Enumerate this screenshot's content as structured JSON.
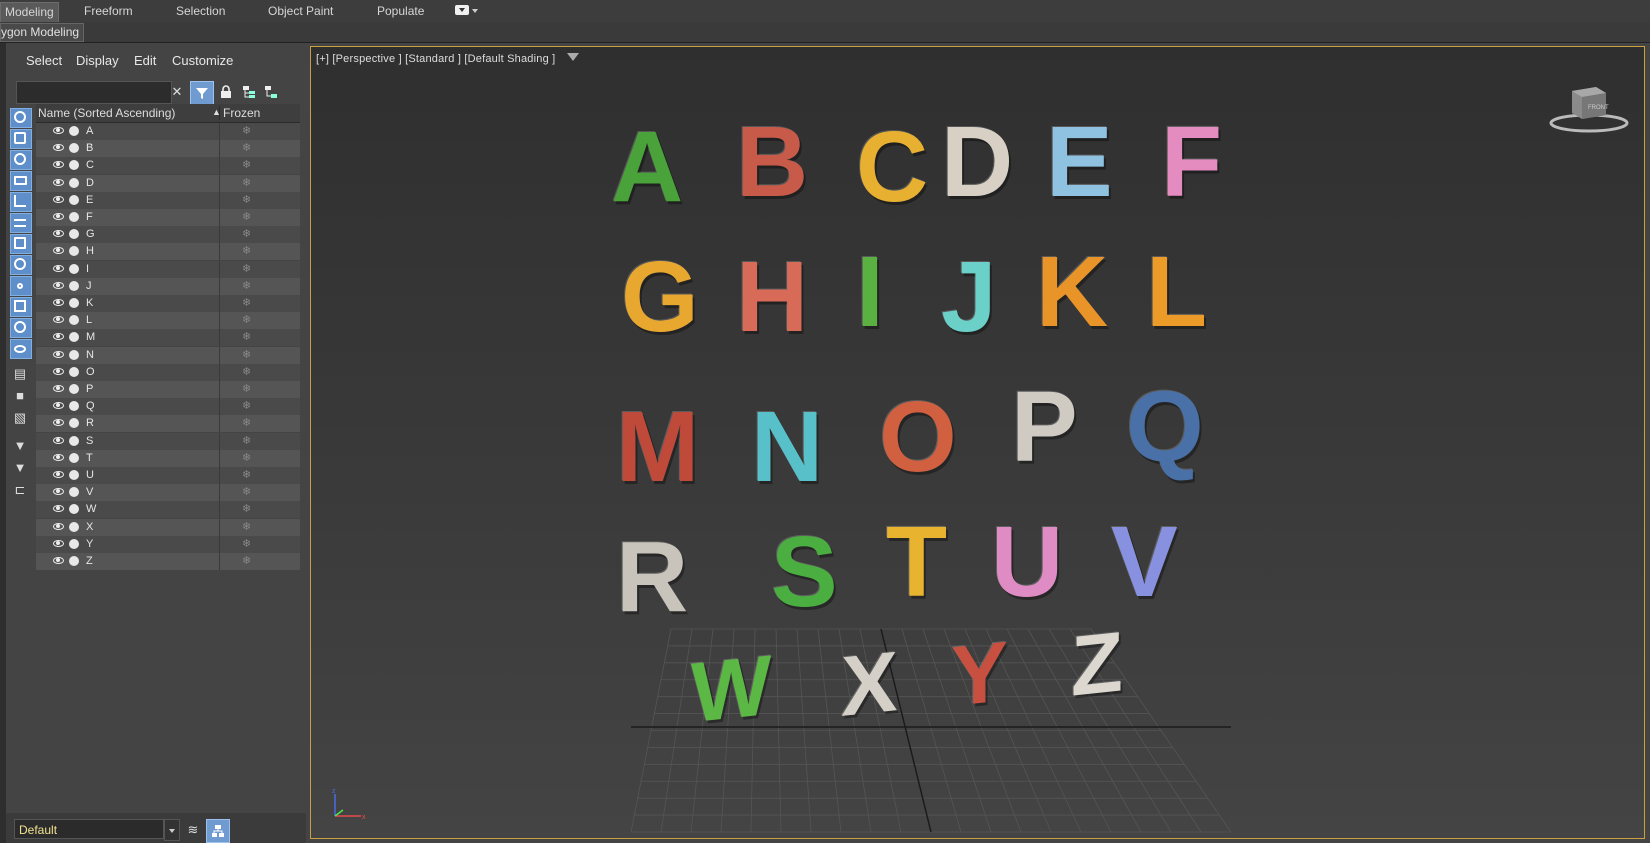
{
  "ribbon": {
    "tabs": [
      "Modeling",
      "Freeform",
      "Selection",
      "Object Paint",
      "Populate"
    ],
    "active": "Modeling",
    "sub_tab": "ygon Modeling"
  },
  "scene_explorer": {
    "menu": [
      "Select",
      "Display",
      "Edit",
      "Customize"
    ],
    "search_placeholder": "",
    "column_name": "Name (Sorted Ascending)",
    "column_frozen": "Frozen",
    "sort_indicator": "▲",
    "objects": [
      "A",
      "B",
      "C",
      "D",
      "E",
      "F",
      "G",
      "H",
      "I",
      "J",
      "K",
      "L",
      "M",
      "N",
      "O",
      "P",
      "Q",
      "R",
      "S",
      "T",
      "U",
      "V",
      "W",
      "X",
      "Y",
      "Z"
    ],
    "frozen_icon": "❄",
    "layer": "Default"
  },
  "viewport": {
    "label": "[+] [Perspective ] [Standard ] [Default Shading ]",
    "viewcube_label": "FRONT",
    "letters": [
      {
        "ch": "A",
        "color": "#4aa33a"
      },
      {
        "ch": "B",
        "color": "#c85a4a"
      },
      {
        "ch": "C",
        "color": "#e8b030"
      },
      {
        "ch": "D",
        "color": "#d8d0c4"
      },
      {
        "ch": "E",
        "color": "#8ec2e0"
      },
      {
        "ch": "F",
        "color": "#e48cc0"
      },
      {
        "ch": "G",
        "color": "#e8a830"
      },
      {
        "ch": "H",
        "color": "#d86a58"
      },
      {
        "ch": "I",
        "color": "#5ab040"
      },
      {
        "ch": "J",
        "color": "#6ad0c8"
      },
      {
        "ch": "K",
        "color": "#e89428"
      },
      {
        "ch": "L",
        "color": "#ec9a28"
      },
      {
        "ch": "M",
        "color": "#c04a3a"
      },
      {
        "ch": "N",
        "color": "#58c0c8"
      },
      {
        "ch": "O",
        "color": "#d06040"
      },
      {
        "ch": "P",
        "color": "#cfcac2"
      },
      {
        "ch": "Q",
        "color": "#4a70a8"
      },
      {
        "ch": "R",
        "color": "#c8c4bc"
      },
      {
        "ch": "S",
        "color": "#4aae40"
      },
      {
        "ch": "T",
        "color": "#e8b430"
      },
      {
        "ch": "U",
        "color": "#e08cc4"
      },
      {
        "ch": "V",
        "color": "#8890e0"
      },
      {
        "ch": "W",
        "color": "#5cb844"
      },
      {
        "ch": "X",
        "color": "#d4d0c8"
      },
      {
        "ch": "Y",
        "color": "#c85040"
      },
      {
        "ch": "Z",
        "color": "#dcd8d0"
      }
    ]
  }
}
